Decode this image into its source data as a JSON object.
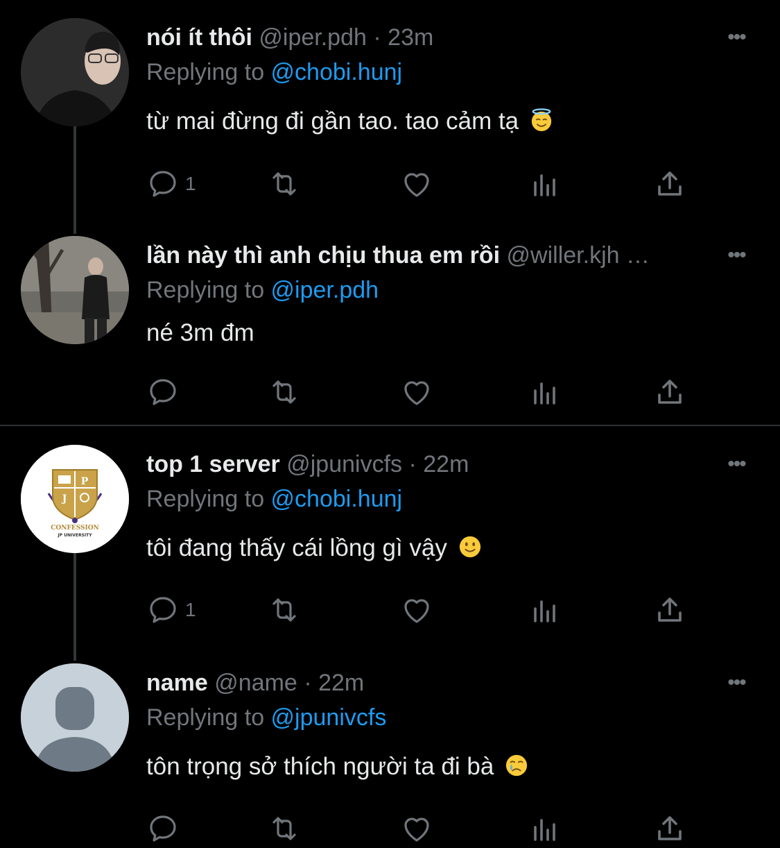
{
  "tweets": [
    {
      "name": "nói ít thôi",
      "handle": "@iper.pdh",
      "dot": "·",
      "time": "23m",
      "replying_prefix": "Replying to ",
      "replying_to": "@chobi.hunj",
      "text": "từ mai đừng đi gần tao. tao cảm tạ",
      "emoji": "smiling-face-with-halo",
      "reply_count": "1"
    },
    {
      "name": "lần này thì anh chịu thua em rồi",
      "handle": "@willer.kjh …",
      "dot": "",
      "time": "",
      "replying_prefix": "Replying to ",
      "replying_to": "@iper.pdh",
      "text": "né 3m đm",
      "emoji": "",
      "reply_count": ""
    },
    {
      "name": "top 1 server",
      "handle": "@jpunivcfs",
      "dot": "·",
      "time": "22m",
      "replying_prefix": "Replying to ",
      "replying_to": "@chobi.hunj",
      "text": "tôi đang thấy cái lồng gì vậy",
      "emoji": "slightly-smiling-face",
      "reply_count": "1",
      "avatar_logo": {
        "letters": [
          "P",
          "J"
        ],
        "line1": "CONFESSION",
        "line2": "JP UNIVERSITY"
      }
    },
    {
      "name": "name",
      "handle": "@name",
      "dot": "·",
      "time": "22m",
      "replying_prefix": "Replying to ",
      "replying_to": "@jpunivcfs",
      "text": "tôn trọng sở thích người ta đi bà",
      "emoji": "crying-face",
      "reply_count": ""
    }
  ],
  "more_label": "•••",
  "colors": {
    "background": "#000000",
    "primary_text": "#e7e9ea",
    "secondary_text": "#71767b",
    "link": "#1d9bf0",
    "divider": "#2f3336"
  }
}
